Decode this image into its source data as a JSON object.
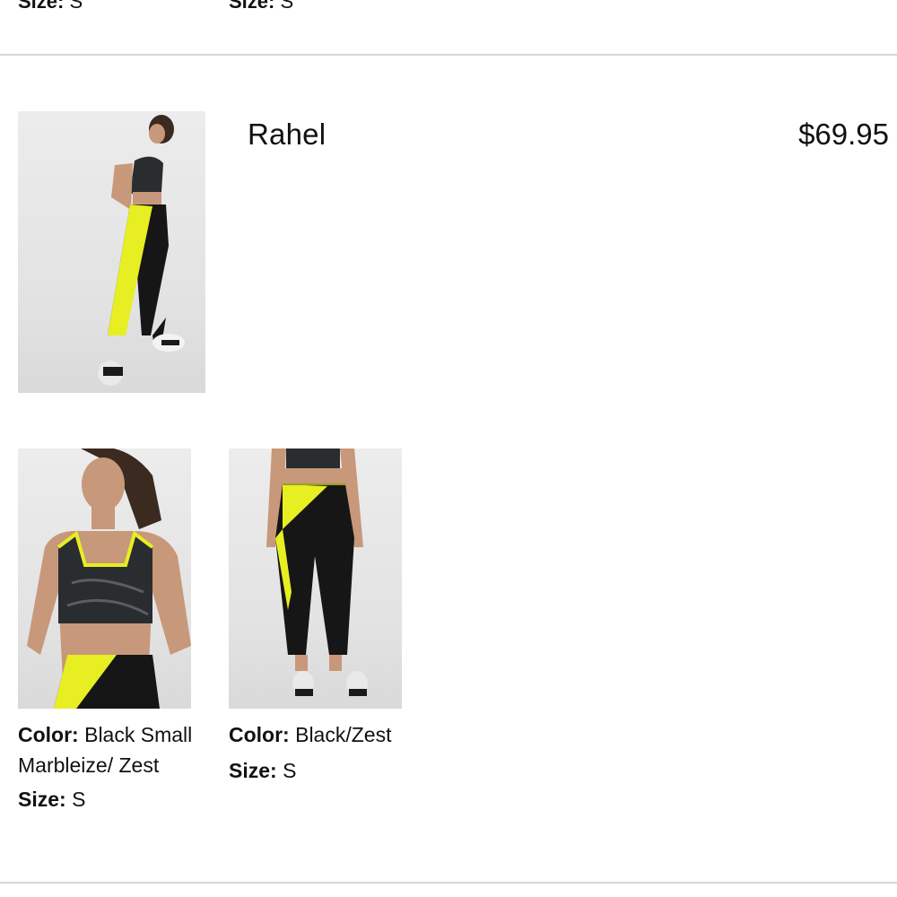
{
  "previous_items": [
    {
      "size_label": "Size:",
      "size_value": "S"
    },
    {
      "size_label": "Size:",
      "size_value": "S"
    }
  ],
  "outfit": {
    "name": "Rahel",
    "price": "$69.95",
    "main_photo_icon": "model-full-body-photo"
  },
  "items": [
    {
      "photo_icon": "sports-bra-photo",
      "color_label": "Color:",
      "color_value": "Black Small Marbleize/ Zest",
      "size_label": "Size:",
      "size_value": "S"
    },
    {
      "photo_icon": "leggings-photo",
      "color_label": "Color:",
      "color_value": "Black/Zest",
      "size_label": "Size:",
      "size_value": "S"
    }
  ],
  "colors": {
    "zest": "#e7ee22",
    "divider": "#d6d6d6"
  }
}
